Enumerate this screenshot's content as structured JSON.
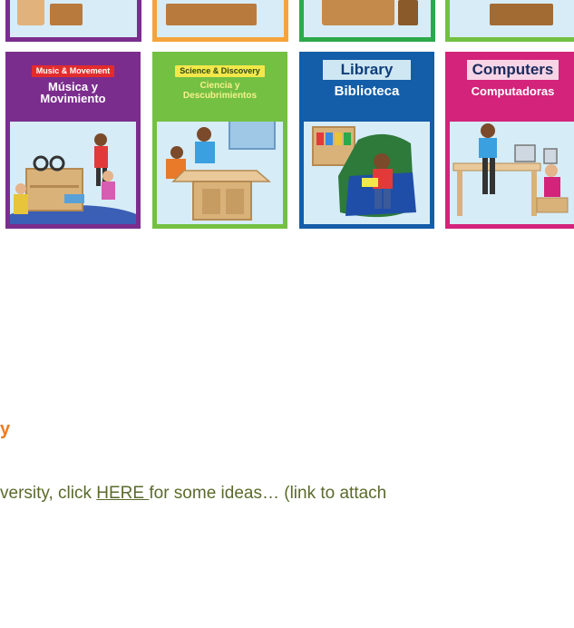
{
  "cards": [
    {
      "title_en": "Music & Movement",
      "title_es": "Música y Movimiento",
      "border_color": "#7b2d8e",
      "banner_color": "#7b2d8e",
      "title_bg": "#e22c2c",
      "title_color": "#ffffff",
      "sub_color": "#ffffff"
    },
    {
      "title_en": "Science & Discovery",
      "title_es": "Ciencia y Descubrimientos",
      "border_color": "#74c043",
      "banner_color": "#74c043",
      "title_bg": "#f3e84a",
      "title_color": "#2c4a16",
      "sub_color": "#f7f08a"
    },
    {
      "title_en": "Library",
      "title_es": "Biblioteca",
      "border_color": "#145da8",
      "banner_color": "#145da8",
      "title_bg": "#cfe7f3",
      "title_color": "#0e3e7a",
      "sub_color": "#ffffff"
    },
    {
      "title_en": "Computers",
      "title_es": "Computadoras",
      "border_color": "#d4237a",
      "banner_color": "#d4237a",
      "title_bg": "#f7d5e6",
      "title_color": "#1b2a5c",
      "sub_color": "#ffffff"
    }
  ],
  "top_row_colors": [
    "#7b2d8e",
    "#f4a43b",
    "#2ea84a",
    "#74c043"
  ],
  "heading": "y",
  "body": {
    "before_link": "versity, click ",
    "link_text": "HERE ",
    "after_link": "for some ideas… (link to attach"
  },
  "colors": {
    "heading": "#f07a1e",
    "body_text": "#5a6b2c"
  }
}
